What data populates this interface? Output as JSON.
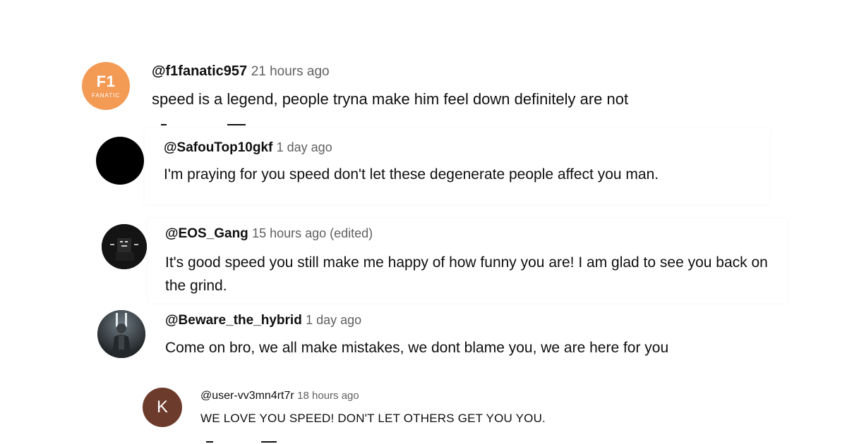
{
  "comments": [
    {
      "handle": "@f1fanatic957",
      "time": "21 hours ago",
      "text": "speed is a legend, people tryna make him feel down definitely are not",
      "avatar": {
        "line1": "F1",
        "line2": "FANATIC",
        "color": "#f39a55"
      }
    },
    {
      "handle": "@SafouTop10gkf",
      "time": "1 day ago",
      "text": "I'm praying for you speed don't let these degenerate people affect you man.",
      "avatar": {
        "color": "#000000"
      }
    },
    {
      "handle": "@EOS_Gang",
      "time": "15 hours ago (edited)",
      "text": "It's good speed you still make me happy of how funny you are! I am glad to see you back on the grind.",
      "avatar": {
        "color": "#111111"
      }
    },
    {
      "handle": "@Beware_the_hybrid",
      "time": "1 day ago",
      "text": "Come on bro, we all make mistakes, we dont blame you, we are here for you",
      "avatar": {
        "color": "#2a2f33"
      }
    },
    {
      "handle": "@user-vv3mn4rt7r",
      "time": "18 hours ago",
      "text": "WE LOVE YOU SPEED! DON'T LET OTHERS GET YOU YOU.",
      "avatar": {
        "letter": "K",
        "color": "#6d3b2b"
      }
    }
  ]
}
